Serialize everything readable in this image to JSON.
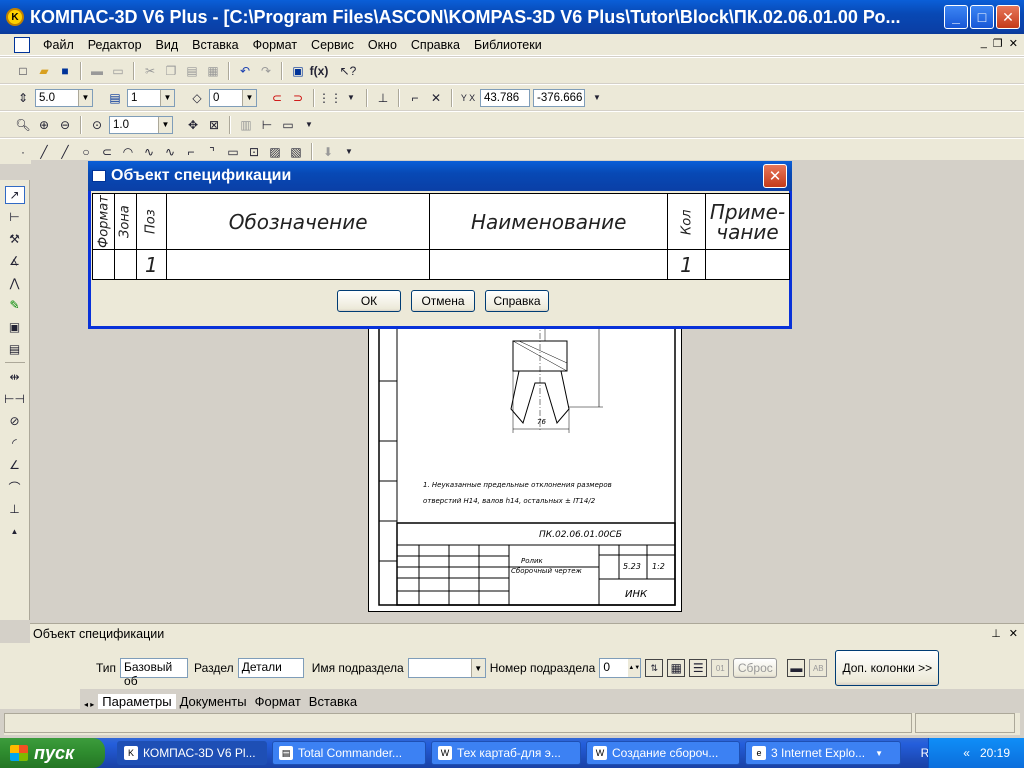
{
  "window": {
    "title": "КОМПАС-3D V6 Plus - [C:\\Program Files\\ASCON\\KOMPAS-3D V6 Plus\\Tutor\\Block\\ПК.02.06.01.00 Ро...",
    "minimize": "_",
    "maximize": "□",
    "close": "✕"
  },
  "menu": {
    "items": [
      "Файл",
      "Редактор",
      "Вид",
      "Вставка",
      "Формат",
      "Сервис",
      "Окно",
      "Справка",
      "Библиотеки"
    ]
  },
  "toolbar": {
    "step": "5.0",
    "layer": "1",
    "style": "0",
    "coord_x": "43.786",
    "coord_y": "-376.666",
    "zoom": "1.0"
  },
  "dialog": {
    "title": "Объект спецификации",
    "columns": {
      "format": "Формат",
      "zone": "Зона",
      "pos": "Поз",
      "designation": "Обозначение",
      "name": "Наименование",
      "qty": "Кол",
      "note": "Приме-\nчание"
    },
    "row": {
      "pos": "1",
      "qty": "1"
    },
    "buttons": {
      "ok": "ОК",
      "cancel": "Отмена",
      "help": "Справка"
    }
  },
  "properties": {
    "header": "Объект спецификации",
    "type_label": "Тип",
    "type_value": "Базовый об",
    "section_label": "Раздел",
    "section_value": "Детали",
    "subsection_name_label": "Имя подраздела",
    "subsection_name_value": "",
    "subsection_num_label": "Номер подраздела",
    "subsection_num_value": "0",
    "reset": "Сброс",
    "extra_columns": "Доп. колонки  >>",
    "tabs": [
      "Параметры",
      "Документы",
      "Формат",
      "Вставка"
    ]
  },
  "drawing": {
    "code": "ПК.02.06.01.00СБ",
    "part_name": "Ролик",
    "doc_type": "Сборочный чертеж",
    "sheet_mass": "5.23",
    "scale": "1:2",
    "org": "ИНК",
    "note": "1. Неуказанные предельные отклонения размеров отверстий Н14, валов h14, остальных ± IT14/2",
    "dim_76": "76"
  },
  "taskbar": {
    "start": "пуск",
    "tasks": [
      "КОМПАС-3D V6 Pl...",
      "Total Commander...",
      "Тех картаб-для э...",
      "Создание сбороч...",
      "3 Internet Explo..."
    ],
    "lang": "RU",
    "clock": "20:19"
  }
}
